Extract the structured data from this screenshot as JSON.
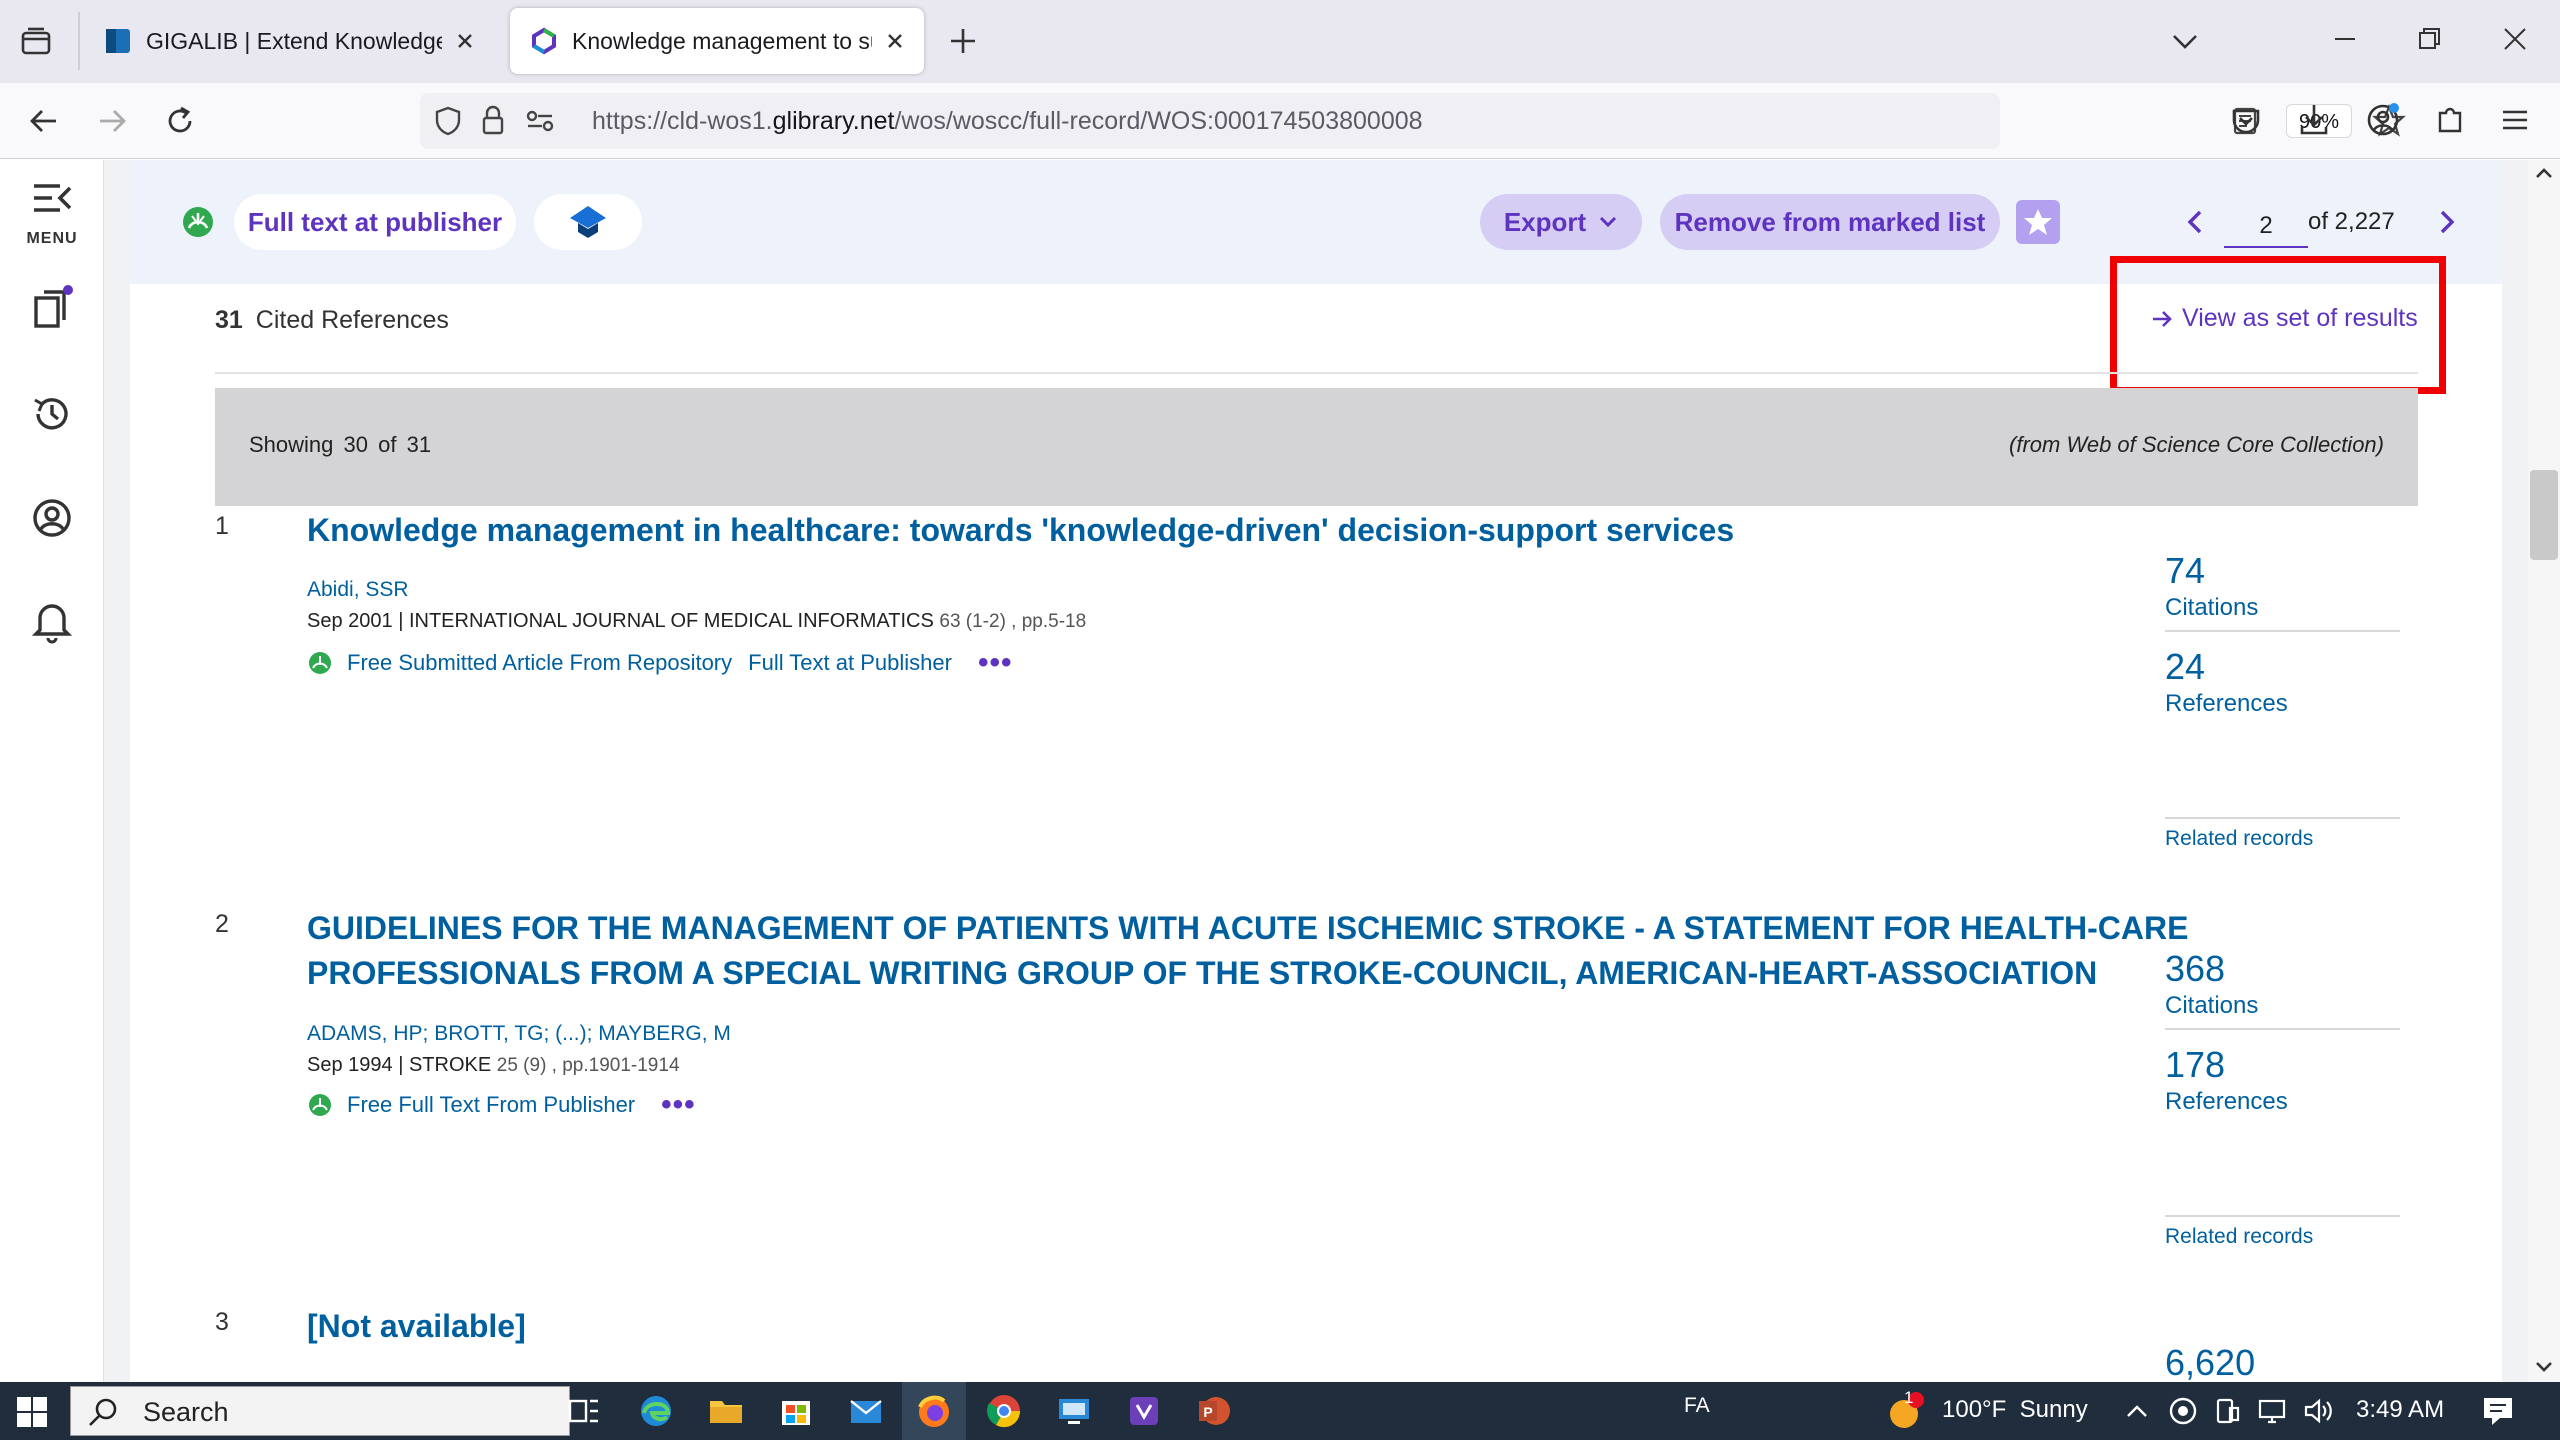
{
  "browser": {
    "tabs": [
      {
        "title": "GIGALIB | Extend Knowledge"
      },
      {
        "title": "Knowledge management to sup"
      }
    ],
    "url_prefix": "https://cld-wos1.",
    "url_host": "glibrary.net",
    "url_path": "/wos/woscc/full-record/WOS:000174503800008",
    "zoom": "90%"
  },
  "sidebar": {
    "menu_label": "MENU"
  },
  "actionbar": {
    "full_text_label": "Full text at publisher",
    "export_label": "Export",
    "remove_label": "Remove from marked list",
    "page_current": "2",
    "page_total": "of 2,227"
  },
  "cited": {
    "count": "31",
    "label": "Cited References",
    "view_set_label": "View as set of results",
    "showing_prefix": "Showing",
    "showing_count": "30",
    "showing_of": "of",
    "showing_total": "31",
    "source_note": "(from Web of Science Core Collection)"
  },
  "records": [
    {
      "num": "1",
      "title": "Knowledge management in healthcare: towards 'knowledge-driven' decision-support services",
      "authors": "Abidi, SSR",
      "date": "Sep 2001",
      "journal": "INTERNATIONAL JOURNAL OF MEDICAL INFORMATICS",
      "vol": "63 (1-2) , pp.5-18",
      "link1": "Free Submitted Article From Repository",
      "link2": "Full Text at Publisher",
      "citations": "74",
      "citations_label": "Citations",
      "references": "24",
      "references_label": "References",
      "related": "Related records"
    },
    {
      "num": "2",
      "title": "GUIDELINES FOR THE MANAGEMENT OF PATIENTS WITH ACUTE ISCHEMIC STROKE - A STATEMENT FOR HEALTH-CARE PROFESSIONALS FROM A SPECIAL WRITING GROUP OF THE STROKE-COUNCIL, AMERICAN-HEART-ASSOCIATION",
      "authors": "ADAMS, HP; BROTT, TG; (...); MAYBERG, M",
      "date": "Sep 1994",
      "journal": "STROKE",
      "vol": "25 (9) , pp.1901-1914",
      "link1": "Free Full Text From Publisher",
      "citations": "368",
      "citations_label": "Citations",
      "references": "178",
      "references_label": "References",
      "related": "Related records"
    },
    {
      "num": "3",
      "title": "[Not available]",
      "citations": "6,620"
    }
  ],
  "taskbar": {
    "search_label": "Search",
    "lang": "FA",
    "weather": "100°F  Sunny",
    "weather_badge": "1",
    "time": "3:49 AM"
  }
}
